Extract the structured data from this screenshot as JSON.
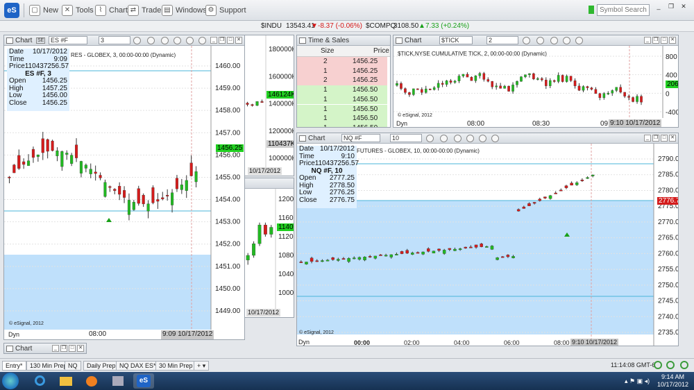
{
  "toolbar": {
    "new": "New",
    "tools": "Tools",
    "chart": "Chart",
    "trade": "Trade",
    "windows": "Windows",
    "support": "Support",
    "search_placeholder": "Symbol Search",
    "logo": "eS"
  },
  "ticker": {
    "indu_sym": "$INDU",
    "indu_val": "13543.41",
    "indu_chg": "-8.37 (-0.06%)",
    "comp_sym": "$COMPQ",
    "comp_val": "3108.50",
    "comp_chg": "7.33 (+0.24%)"
  },
  "es_chart": {
    "title": "Chart",
    "symbol": "ES #F",
    "interval": "3",
    "desc": "RES - GLOBEX, 3, 00:00-00:00 (Dynamic)",
    "info": {
      "date": "10/17/2012",
      "time": "9:09",
      "price": "110437256.57",
      "sym": "ES #F, 3",
      "open": "1456.25",
      "high": "1457.25",
      "low": "1456.00",
      "close": "1456.25"
    },
    "last": "1456.25",
    "prices": [
      "1460.00",
      "1459.00",
      "1458.00",
      "1457.00",
      "1456.00",
      "1455.00",
      "1454.00",
      "1453.00",
      "1452.00",
      "1451.00",
      "1450.00",
      "1449.00"
    ],
    "xlabel": "08:00",
    "datebox": "9:09 10/17/2012",
    "dyn": "Dyn",
    "copy": "© eSignal, 2012"
  },
  "mid_chart1": {
    "prices": [
      "180000K",
      "160000K",
      "140000K",
      "120000K",
      "100000K"
    ],
    "badge1": "146124K",
    "badge2": "110437K",
    "date": "10/17/2012"
  },
  "mid_chart2": {
    "prices": [
      "1200",
      "1160",
      "1120",
      "1080",
      "1040",
      "1000"
    ],
    "badge": "1140",
    "date": "10/17/2012"
  },
  "ts": {
    "title": "Time & Sales",
    "size_hdr": "Size",
    "price_hdr": "Price",
    "rows": [
      {
        "s": "2",
        "p": "1456.25",
        "c": "r"
      },
      {
        "s": "1",
        "p": "1456.25",
        "c": "r"
      },
      {
        "s": "2",
        "p": "1456.25",
        "c": "r"
      },
      {
        "s": "1",
        "p": "1456.50",
        "c": "g"
      },
      {
        "s": "1",
        "p": "1456.50",
        "c": "g"
      },
      {
        "s": "1",
        "p": "1456.50",
        "c": "g"
      },
      {
        "s": "1",
        "p": "1456.50",
        "c": "g"
      },
      {
        "s": "1",
        "p": "1456.50",
        "c": "g"
      }
    ]
  },
  "tick_chart": {
    "title": "Chart",
    "symbol": "$TICK",
    "interval": "2",
    "desc": "$TICK,NYSE CUMULATIVE TICK, 2, 00:00-00:00 (Dynamic)",
    "prices": [
      "800",
      "400",
      "0",
      "-400"
    ],
    "badge": "206",
    "x1": "08:00",
    "x2": "08:30",
    "x3": "09",
    "datebox": "9:10 10/17/2012",
    "dyn": "Dyn",
    "copy": "© eSignal, 2012"
  },
  "nq_chart": {
    "title": "Chart",
    "symbol": "NQ #F",
    "interval": "10",
    "desc": "FUTURES - GLOBEX, 10, 00:00-00:00 (Dynamic)",
    "info": {
      "date": "10/17/2012",
      "time": "9:10",
      "price": "110437256.57",
      "sym": "NQ #F, 10",
      "open": "2777.25",
      "high": "2778.50",
      "low": "2776.25",
      "close": "2776.75"
    },
    "last": "2776.75",
    "prices": [
      "2790.00",
      "2785.00",
      "2780.00",
      "2775.00",
      "2770.00",
      "2765.00",
      "2760.00",
      "2755.00",
      "2750.00",
      "2745.00",
      "2740.00",
      "2735.00"
    ],
    "x": [
      "00:00",
      "02:00",
      "04:00",
      "06:00",
      "08:00"
    ],
    "datebox": "9:10 10/17/2012",
    "dyn": "Dyn",
    "copy": "© eSignal, 2012"
  },
  "mini_chart": {
    "title": "Chart"
  },
  "tabs": [
    "Entry*",
    "130 Min Prep",
    "NQ",
    "Daily Prep",
    "NQ DAX ES*",
    "30 Min Prep"
  ],
  "status": {
    "time": "11:14:08 GMT-6"
  },
  "clock": {
    "time": "9:14 AM",
    "date": "10/17/2012"
  },
  "colors": {
    "up": "#22b822",
    "down": "#d41c1c",
    "zone": "#bfe0fb",
    "badge": "#20d020"
  }
}
